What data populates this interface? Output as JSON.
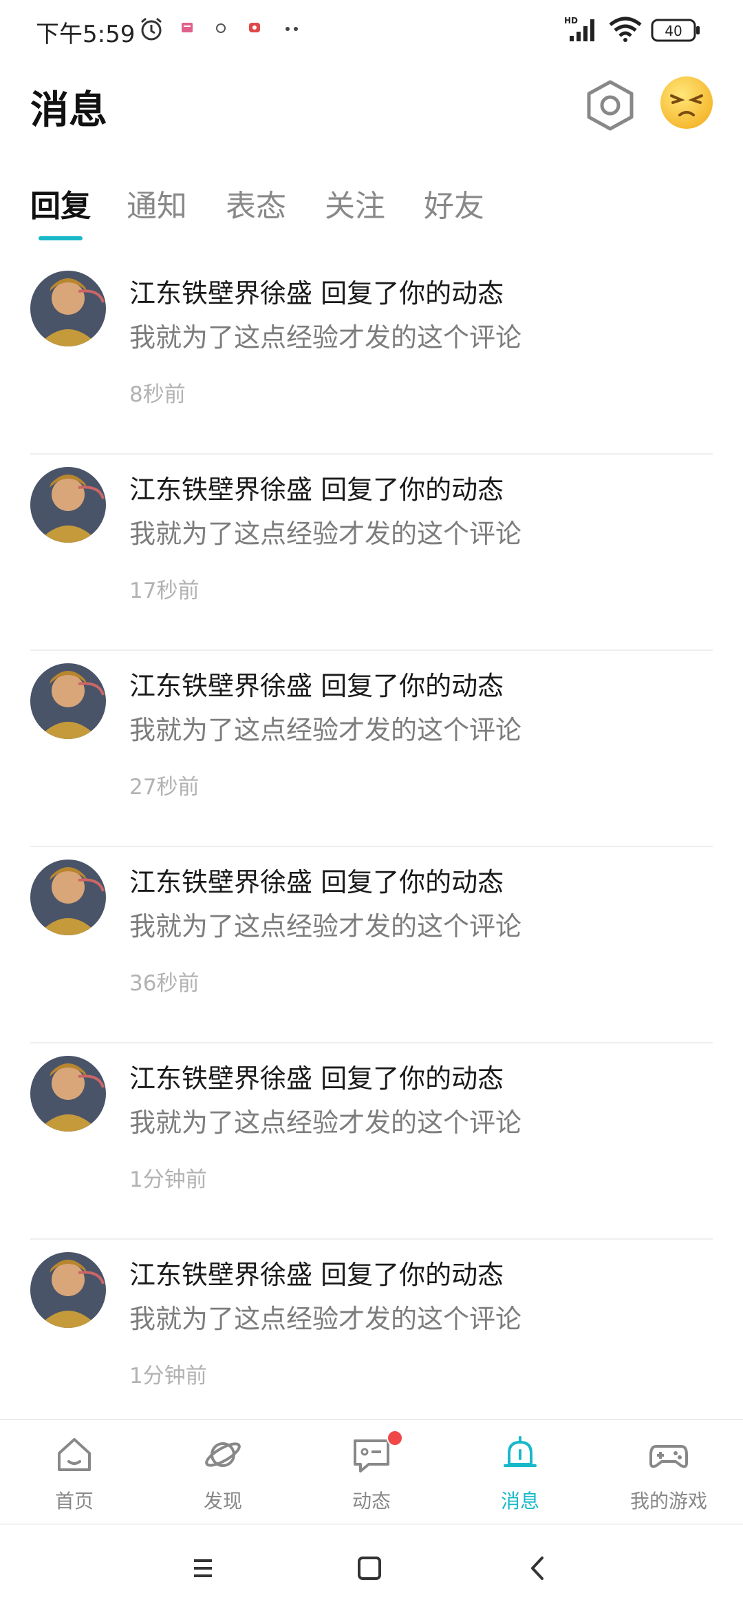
{
  "status_bar": {
    "time": "下午5:59",
    "battery": "40",
    "network": "HD"
  },
  "header": {
    "title": "消息"
  },
  "tabs": [
    {
      "label": "回复",
      "active": true
    },
    {
      "label": "通知",
      "active": false
    },
    {
      "label": "表态",
      "active": false
    },
    {
      "label": "关注",
      "active": false
    },
    {
      "label": "好友",
      "active": false
    }
  ],
  "messages": [
    {
      "title": "江东铁壁界徐盛 回复了你的动态",
      "body": "我就为了这点经验才发的这个评论",
      "time": "8秒前"
    },
    {
      "title": "江东铁壁界徐盛 回复了你的动态",
      "body": "我就为了这点经验才发的这个评论",
      "time": "17秒前"
    },
    {
      "title": "江东铁壁界徐盛 回复了你的动态",
      "body": "我就为了这点经验才发的这个评论",
      "time": "27秒前"
    },
    {
      "title": "江东铁壁界徐盛 回复了你的动态",
      "body": "我就为了这点经验才发的这个评论",
      "time": "36秒前"
    },
    {
      "title": "江东铁壁界徐盛 回复了你的动态",
      "body": "我就为了这点经验才发的这个评论",
      "time": "1分钟前"
    },
    {
      "title": "江东铁壁界徐盛 回复了你的动态",
      "body": "我就为了这点经验才发的这个评论",
      "time": "1分钟前"
    }
  ],
  "bottom_nav": [
    {
      "label": "首页",
      "icon": "home-icon",
      "active": false
    },
    {
      "label": "发现",
      "icon": "planet-icon",
      "active": false
    },
    {
      "label": "动态",
      "icon": "chat-icon",
      "active": false,
      "badge": true
    },
    {
      "label": "消息",
      "icon": "bell-icon",
      "active": true
    },
    {
      "label": "我的游戏",
      "icon": "gamepad-icon",
      "active": false
    }
  ],
  "colors": {
    "accent": "#17b8c8",
    "badge": "#f04848",
    "primary_text": "#1a1a1a",
    "secondary_text": "#7d7d7d",
    "muted_text": "#b2b2b2"
  }
}
